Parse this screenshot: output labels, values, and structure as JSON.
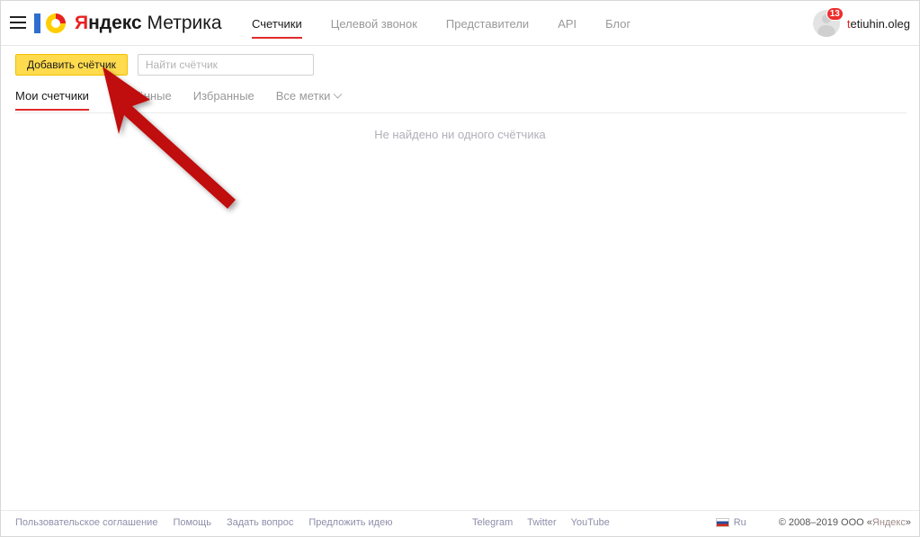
{
  "header": {
    "menu_icon": "hamburger-menu-icon",
    "logo": {
      "ya": "Я",
      "ndex": "ндекс",
      "product": " Метрика"
    },
    "nav": [
      {
        "label": "Счетчики",
        "active": true
      },
      {
        "label": "Целевой звонок",
        "active": false
      },
      {
        "label": "Представители",
        "active": false
      },
      {
        "label": "API",
        "active": false
      },
      {
        "label": "Блог",
        "active": false
      }
    ],
    "user": {
      "name_first": "t",
      "name_rest": "etiuhin.oleg",
      "notification_count": "13",
      "avatar_icon": "user-avatar-icon"
    }
  },
  "toolbar": {
    "add_counter_label": "Добавить счётчик",
    "search_placeholder": "Найти счётчик",
    "search_value": ""
  },
  "tabs": [
    {
      "label": "Мои счетчики",
      "active": true
    },
    {
      "label": "Удалённые",
      "active": false
    },
    {
      "label": "Избранные",
      "active": false
    },
    {
      "label": "Все метки",
      "active": false,
      "has_chevron": true
    }
  ],
  "main": {
    "empty_message": "Не найдено ни одного счётчика"
  },
  "footer": {
    "links": [
      "Пользовательское соглашение",
      "Помощь",
      "Задать вопрос",
      "Предложить идею"
    ],
    "social": [
      "Telegram",
      "Twitter",
      "YouTube"
    ],
    "language": {
      "label": "Ru",
      "flag_icon": "russia-flag-icon"
    },
    "copyright_prefix": "© 2008–2019 ООО «",
    "copyright_brand": "Яндекс",
    "copyright_suffix": "»"
  },
  "annotation": {
    "arrow_color": "#c00d0d",
    "arrow_target": "add-counter-button"
  },
  "colors": {
    "accent_red": "#e02b2b",
    "brand_yellow": "#ffdb4d",
    "logo_blue": "#2f6dd0",
    "badge_red": "#ee2d2d"
  }
}
